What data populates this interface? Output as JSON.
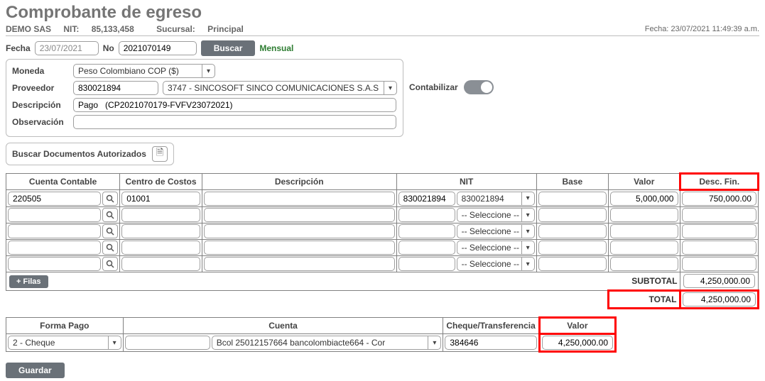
{
  "header": {
    "title": "Comprobante de egreso",
    "company": "DEMO SAS",
    "nit_label": "NIT:",
    "nit": "85,133,458",
    "sucursal_label": "Sucursal:",
    "sucursal": "Principal",
    "fecha_top_label": "Fecha:",
    "fecha_top": "23/07/2021 11:49:39 a.m."
  },
  "search": {
    "fecha_label": "Fecha",
    "fecha_value": "23/07/2021",
    "no_label": "No",
    "no_value": "2021070149",
    "buscar_label": "Buscar",
    "mensual_label": "Mensual"
  },
  "form": {
    "moneda_label": "Moneda",
    "moneda_value": "Peso Colombiano COP ($)",
    "proveedor_label": "Proveedor",
    "proveedor_code": "830021894",
    "proveedor_name": "3747 - SINCOSOFT SINCO COMUNICACIONES S.A.S",
    "descripcion_label": "Descripción",
    "descripcion_value": "Pago   (CP2021070179-FVFV23072021)",
    "observacion_label": "Observación",
    "observacion_value": "",
    "contabilizar_label": "Contabilizar"
  },
  "docs": {
    "label": "Buscar Documentos Autorizados"
  },
  "grid": {
    "headers": {
      "cuenta": "Cuenta Contable",
      "centro": "Centro de Costos",
      "descripcion": "Descripción",
      "nit": "NIT",
      "base": "Base",
      "valor": "Valor",
      "descfin": "Desc. Fin."
    },
    "rows": [
      {
        "cuenta": "220505",
        "centro": "01001",
        "descripcion": "",
        "nit_code": "830021894",
        "nit_sel": "830021894",
        "base": "",
        "valor": "5,000,000",
        "descfin": "750,000.00"
      },
      {
        "cuenta": "",
        "centro": "",
        "descripcion": "",
        "nit_code": "",
        "nit_sel": "-- Seleccione --",
        "base": "",
        "valor": "",
        "descfin": ""
      },
      {
        "cuenta": "",
        "centro": "",
        "descripcion": "",
        "nit_code": "",
        "nit_sel": "-- Seleccione --",
        "base": "",
        "valor": "",
        "descfin": ""
      },
      {
        "cuenta": "",
        "centro": "",
        "descripcion": "",
        "nit_code": "",
        "nit_sel": "-- Seleccione --",
        "base": "",
        "valor": "",
        "descfin": ""
      },
      {
        "cuenta": "",
        "centro": "",
        "descripcion": "",
        "nit_code": "",
        "nit_sel": "-- Seleccione --",
        "base": "",
        "valor": "",
        "descfin": ""
      }
    ],
    "filas_label": "+ Filas",
    "subtotal_label": "SUBTOTAL",
    "subtotal_value": "4,250,000.00",
    "total_label": "TOTAL",
    "total_value": "4,250,000.00"
  },
  "payment": {
    "headers": {
      "forma": "Forma Pago",
      "cuenta": "Cuenta",
      "cheque": "Cheque/Transferencia",
      "valor": "Valor"
    },
    "forma_value": "2 - Cheque",
    "cuenta_code": "",
    "cuenta_value": "Bcol 25012157664 bancolombiacte664 - Cor",
    "cheque_value": "384646",
    "valor_value": "4,250,000.00"
  },
  "footer": {
    "guardar_label": "Guardar"
  }
}
